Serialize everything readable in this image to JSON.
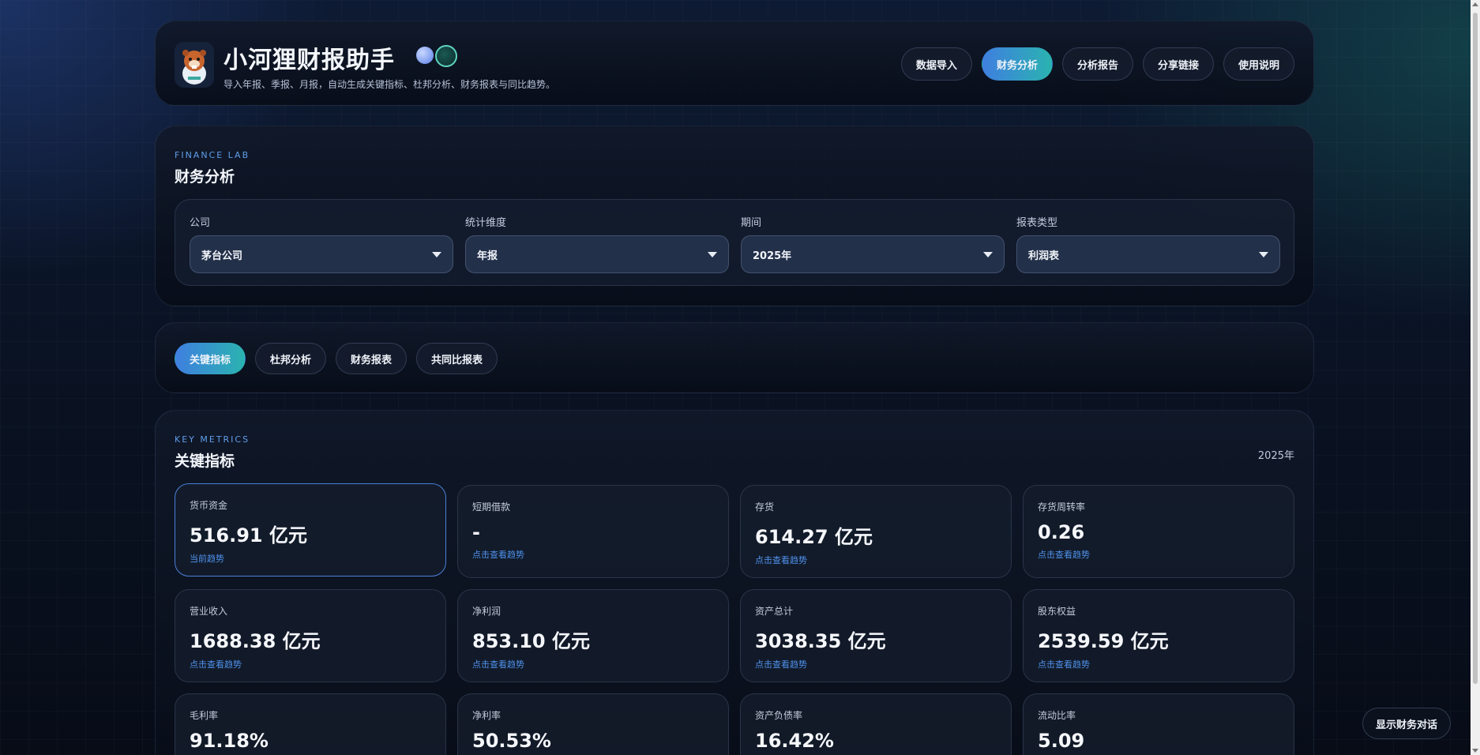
{
  "header": {
    "title": "小河狸财报助手",
    "subtitle": "导入年报、季报、月报，自动生成关键指标、杜邦分析、财务报表与同比趋势。",
    "nav": [
      {
        "label": "数据导入",
        "active": false
      },
      {
        "label": "财务分析",
        "active": true
      },
      {
        "label": "分析报告",
        "active": false
      },
      {
        "label": "分享链接",
        "active": false
      },
      {
        "label": "使用说明",
        "active": false
      }
    ]
  },
  "analysis": {
    "eyebrow": "FINANCE LAB",
    "title": "财务分析",
    "filters": [
      {
        "label": "公司",
        "value": "茅台公司"
      },
      {
        "label": "统计维度",
        "value": "年报"
      },
      {
        "label": "期间",
        "value": "2025年"
      },
      {
        "label": "报表类型",
        "value": "利润表"
      }
    ]
  },
  "tabs": [
    {
      "label": "关键指标",
      "active": true
    },
    {
      "label": "杜邦分析",
      "active": false
    },
    {
      "label": "财务报表",
      "active": false
    },
    {
      "label": "共同比报表",
      "active": false
    }
  ],
  "metrics": {
    "eyebrow": "KEY METRICS",
    "title": "关键指标",
    "period": "2025年",
    "cards": [
      {
        "label": "货币资金",
        "value": "516.91 亿元",
        "link": "当前趋势",
        "selected": true
      },
      {
        "label": "短期借款",
        "value": "-",
        "link": "点击查看趋势",
        "selected": false
      },
      {
        "label": "存货",
        "value": "614.27 亿元",
        "link": "点击查看趋势",
        "selected": false
      },
      {
        "label": "存货周转率",
        "value": "0.26",
        "link": "点击查看趋势",
        "selected": false
      },
      {
        "label": "营业收入",
        "value": "1688.38 亿元",
        "link": "点击查看趋势",
        "selected": false
      },
      {
        "label": "净利润",
        "value": "853.10 亿元",
        "link": "点击查看趋势",
        "selected": false
      },
      {
        "label": "资产总计",
        "value": "3038.35 亿元",
        "link": "点击查看趋势",
        "selected": false
      },
      {
        "label": "股东权益",
        "value": "2539.59 亿元",
        "link": "点击查看趋势",
        "selected": false
      },
      {
        "label": "毛利率",
        "value": "91.18%",
        "link": "",
        "selected": false
      },
      {
        "label": "净利率",
        "value": "50.53%",
        "link": "",
        "selected": false
      },
      {
        "label": "资产负债率",
        "value": "16.42%",
        "link": "",
        "selected": false
      },
      {
        "label": "流动比率",
        "value": "5.09",
        "link": "",
        "selected": false
      }
    ]
  },
  "chat_button": "显示财务对话",
  "colors": {
    "accent_start": "#3f7fe0",
    "accent_end": "#2ab3b0",
    "link": "#4f92ec"
  }
}
